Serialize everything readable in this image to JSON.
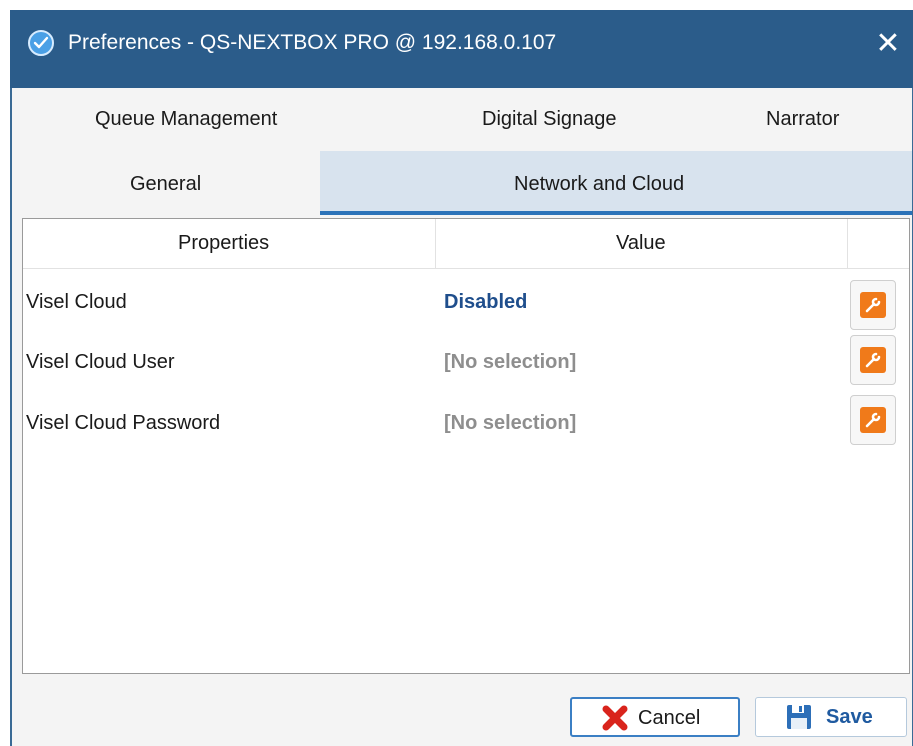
{
  "window": {
    "title": "Preferences - QS-NEXTBOX PRO @ 192.168.0.107",
    "close_glyph": "✕",
    "app_icon": "app-logo-icon"
  },
  "tabs": {
    "row1": [
      {
        "label": "Queue Management",
        "active": false
      },
      {
        "label": "Digital Signage",
        "active": false
      },
      {
        "label": "Narrator",
        "active": false
      }
    ],
    "row2": [
      {
        "label": "General",
        "active": false
      },
      {
        "label": "Network and Cloud",
        "active": true
      }
    ]
  },
  "grid": {
    "headers": {
      "properties": "Properties",
      "value": "Value"
    },
    "rows": [
      {
        "property": "Visel Cloud",
        "value": "Disabled",
        "value_state": "set",
        "action_icon": "wrench-icon"
      },
      {
        "property": "Visel Cloud User",
        "value": "[No selection]",
        "value_state": "empty",
        "action_icon": "wrench-icon"
      },
      {
        "property": "Visel Cloud Password",
        "value": "[No selection]",
        "value_state": "empty",
        "action_icon": "wrench-icon"
      }
    ]
  },
  "footer": {
    "cancel_label": "Cancel",
    "cancel_icon": "red-x-icon",
    "save_label": "Save",
    "save_icon": "floppy-disk-icon"
  },
  "colors": {
    "titlebar": "#2b5c8a",
    "active_tab": "#d8e3ee",
    "active_tab_underline": "#2b72b8",
    "value_set": "#1f4e8c",
    "value_empty": "#8e8e8e",
    "wrench_button": "#f07a1a",
    "cancel_icon": "#d9241c",
    "save_icon": "#2d6fb8"
  }
}
